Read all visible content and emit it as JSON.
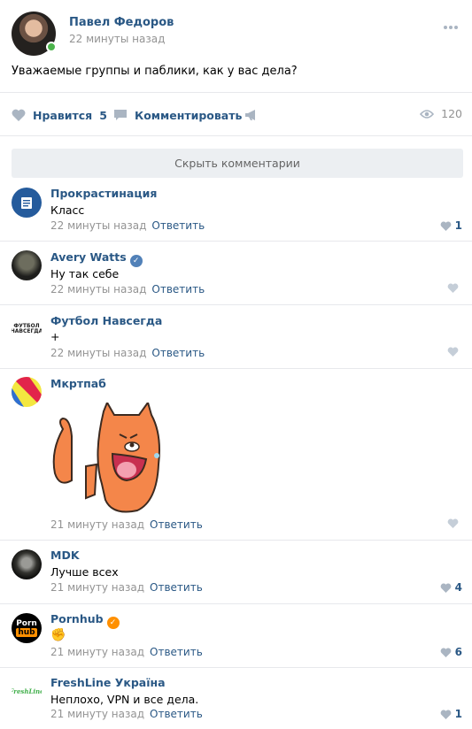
{
  "post": {
    "author": "Павел Федоров",
    "time": "22 минуты назад",
    "text": "Уважаемые группы и паблики, как у вас дела?",
    "like_label": "Нравится",
    "like_count": "5",
    "comment_label": "Комментировать",
    "views": "120"
  },
  "hide_comments_label": "Скрыть комментарии",
  "comments": [
    {
      "name": "Прокрастинация",
      "text": "Класс",
      "time": "22 минуты назад",
      "reply": "Ответить",
      "likes": "1"
    },
    {
      "name": "Avery Watts",
      "text": "Ну так себе",
      "time": "22 минуты назад",
      "reply": "Ответить",
      "likes": ""
    },
    {
      "name": "Футбол Навсегда",
      "text": "+",
      "time": "22 минуты назад",
      "reply": "Ответить",
      "likes": "",
      "avatar_text": "ФУТБОЛ НАВСЕГДА"
    },
    {
      "name": "Мкртпаб",
      "text": "",
      "time": "21 минуту назад",
      "reply": "Ответить",
      "likes": ""
    },
    {
      "name": "MDK",
      "text": "Лучше всех",
      "time": "21 минуту назад",
      "reply": "Ответить",
      "likes": "4"
    },
    {
      "name": "Pornhub",
      "text": "✊",
      "time": "21 минуту назад",
      "reply": "Ответить",
      "likes": "6",
      "avatar_text_1": "Porn",
      "avatar_text_2": "hub"
    },
    {
      "name": "FreshLine Україна",
      "text": "Неплохо, VPN и все дела.",
      "time": "21 минуту назад",
      "reply": "Ответить",
      "likes": "1",
      "avatar_text": "FreshLine"
    }
  ],
  "colors": {
    "link": "#2a5885",
    "meta": "#939393",
    "verified": "#5181b8",
    "online": "#4bb34b"
  }
}
